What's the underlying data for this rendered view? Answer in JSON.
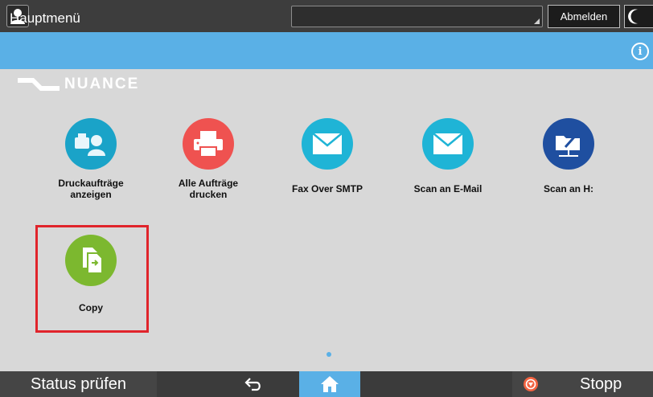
{
  "topbar": {
    "user_icon": "user-icon",
    "logout_label": "Abmelden",
    "sleep_icon": "moon-icon"
  },
  "header": {
    "title": "Hauptmenü",
    "info_icon": "info-icon"
  },
  "logo": {
    "text": "NUANCE"
  },
  "apps": [
    {
      "label_line1": "Druckaufträge",
      "label_line2": "anzeigen",
      "icon": "print-jobs-icon",
      "color": "#1aa3c8"
    },
    {
      "label_line1": "Alle Aufträge",
      "label_line2": "drucken",
      "icon": "printer-icon",
      "color": "#ef5250"
    },
    {
      "label_line1": "Fax Over SMTP",
      "label_line2": "",
      "icon": "envelope-icon",
      "color": "#1fb4d6"
    },
    {
      "label_line1": "Scan an E-Mail",
      "label_line2": "",
      "icon": "envelope-icon",
      "color": "#1fb4d6"
    },
    {
      "label_line1": "Scan an H:",
      "label_line2": "",
      "icon": "network-folder-icon",
      "color": "#1f4fa0"
    },
    {
      "label_line1": "Copy",
      "label_line2": "",
      "icon": "copy-icon",
      "color": "#7cb82f"
    }
  ],
  "highlight_color": "#e0242b",
  "bottombar": {
    "status_label": "Status prüfen",
    "back_icon": "back-arrow-icon",
    "home_icon": "home-icon",
    "stop_label": "Stopp",
    "stop_icon": "stop-icon"
  }
}
